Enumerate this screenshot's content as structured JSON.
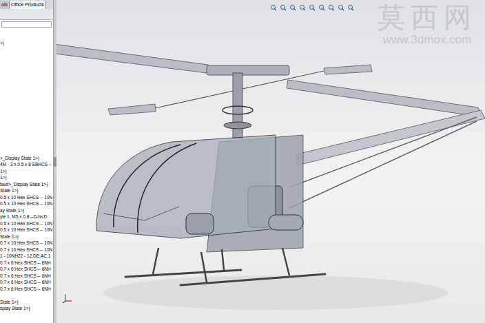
{
  "tabs": [
    {
      "label": "ols",
      "selected": false
    },
    {
      "label": "Office Products",
      "selected": true
    }
  ],
  "tree_top": [
    ">)"
  ],
  "tree_items": [
    {
      "text": ">_Display State 1>)"
    },
    {
      "text": "4M - 3 x 0.5 x 8 SBHCS --"
    },
    {
      "text": "1>)"
    },
    {
      "text": "1>)"
    },
    {
      "text": "fault>_Display State 1>)"
    },
    {
      "text": "State 1>)"
    },
    {
      "text": "0.5 x 10 Hex SHCS -- 10N"
    },
    {
      "text": "0.5 x 10 Hex SHCS -- 10N"
    },
    {
      "text": "ay State 1>)"
    },
    {
      "text": "yle 1,  M5 x 0.8 --D-N<D"
    },
    {
      "text": "0.5 x 10 Hex SHCS -- 10N"
    },
    {
      "text": "0.5 x 10 Hex SHCS -- 10N"
    },
    {
      "text": "State 1>)"
    },
    {
      "text": "0.7 x 10 Hex SHCS -- 10N"
    },
    {
      "text": "0.7 x 10 Hex SHCS -- 10N"
    },
    {
      "text": "1 - 10NH22 - 12,DE,AC,1"
    },
    {
      "text": "0.7 x 6 Hex SHCS -- 6NH"
    },
    {
      "text": "0.7 x 6 Hex SHCS -- 6NH"
    },
    {
      "text": "0.7 x 6 Hex SHCS -- 6NH"
    },
    {
      "text": "0.7 x 6 Hex SHCS -- 6NH"
    },
    {
      "text": "0.7 x 6 Hex SHCS -- 6NH"
    },
    {
      "text": ""
    },
    {
      "text": "State 1>)"
    },
    {
      "text": "splay State 1>)"
    }
  ],
  "watermark": {
    "title": "莫西网",
    "url": "www.3dmox.com"
  }
}
